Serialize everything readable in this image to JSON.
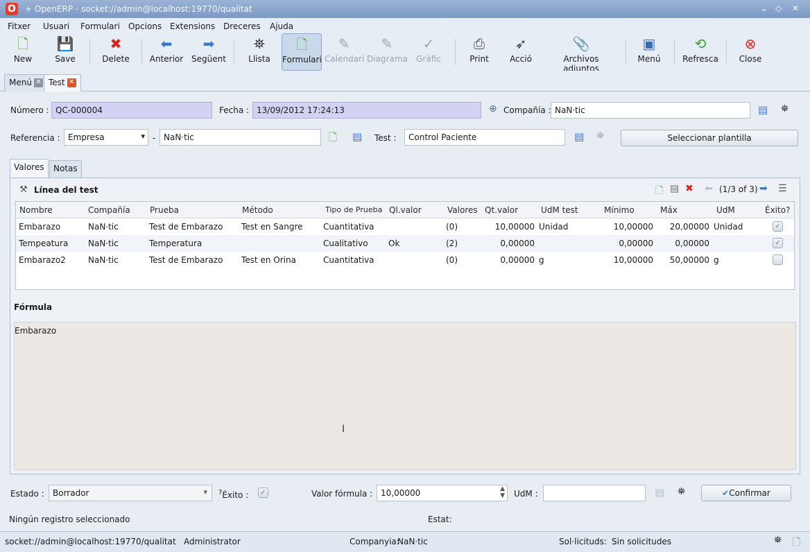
{
  "window": {
    "logo": "O",
    "title": "+ OpenERP - socket://admin@localhost:19770/qualitat",
    "controls": [
      "⌄",
      "◇",
      "✕"
    ]
  },
  "menubar": [
    "Fitxer",
    "Usuari",
    "Formulari",
    "Opcions",
    "Extensions",
    "Dreceres",
    "Ajuda"
  ],
  "toolbar": {
    "new": "New",
    "save": "Save",
    "delete": "Delete",
    "previous": "Anterior",
    "next": "Següent",
    "list": "Llista",
    "form": "Formulari",
    "calendar": "Calendari",
    "graph": "Diagrama",
    "chart": "Gràfic",
    "print": "Print",
    "action": "Acció",
    "attachments": "Archivos adjuntos",
    "menu": "Menú",
    "refresh": "Refresca",
    "close": "Close"
  },
  "tabs": [
    {
      "label": "Menú"
    },
    {
      "label": "Test"
    }
  ],
  "form": {
    "numero_label": "Número :",
    "numero_value": "QC-000004",
    "fecha_label": "Fecha :",
    "fecha_value": "13/09/2012 17:24:13",
    "compania_label": "Compañía :",
    "compania_value": "NaN·tic",
    "referencia_label": "Referencia :",
    "referencia_type": "Empresa",
    "referencia_dash": "-",
    "referencia_value": "NaN·tic",
    "test_label": "Test :",
    "test_value": "Control Paciente",
    "template_button": "Seleccionar plantilla"
  },
  "inner_tabs": [
    "Valores",
    "Notas"
  ],
  "lines": {
    "title": "Línea del test",
    "pager": "(1/3 of 3)",
    "columns": [
      "Nombre",
      "Compañía",
      "Prueba",
      "Método",
      "Tipo de Prueba",
      "Ql.valor",
      "Valores",
      "Qt.valor",
      "UdM test",
      "Mínimo",
      "Máx",
      "UdM",
      "Éxito?"
    ],
    "rows": [
      {
        "nombre": "Embarazo",
        "compania": "NaN·tic",
        "prueba": "Test de Embarazo",
        "metodo": "Test en Sangre",
        "tipo": "Cuantitativa",
        "qlvalor": "",
        "valores": "(0)",
        "qtvalor": "10,00000",
        "udmtest": "Unidad",
        "minimo": "10,00000",
        "max": "20,00000",
        "udm": "Unidad",
        "exito": true
      },
      {
        "nombre": "Tempeatura",
        "compania": "NaN·tic",
        "prueba": "Temperatura",
        "metodo": "",
        "tipo": "Cualitativo",
        "qlvalor": "Ok",
        "valores": "(2)",
        "qtvalor": "0,00000",
        "udmtest": "",
        "minimo": "0,00000",
        "max": "0,00000",
        "udm": "",
        "exito": true
      },
      {
        "nombre": "Embarazo2",
        "compania": "NaN·tic",
        "prueba": "Test de Embarazo",
        "metodo": "Test en Orina",
        "tipo": "Cuantitativa",
        "qlvalor": "",
        "valores": "(0)",
        "qtvalor": "0,00000",
        "udmtest": "g",
        "minimo": "10,00000",
        "max": "50,00000",
        "udm": "g",
        "exito": false
      }
    ]
  },
  "formula": {
    "label": "Fórmula",
    "value": "Embarazo"
  },
  "footer": {
    "estado_label": "Estado :",
    "estado_value": "Borrador",
    "exito_label": "Éxito :",
    "exito_prefix": "?",
    "valor_formula_label": "Valor fórmula :",
    "valor_formula_value": "10,00000",
    "udm_label": "UdM :",
    "udm_value": "",
    "confirm_button": "Confirmar",
    "no_record": "Ningún registro seleccionado",
    "estat_label": "Estat:"
  },
  "statusbar": {
    "connection": "socket://admin@localhost:19770/qualitat",
    "user": "Administrator",
    "company_label": "Companyia:",
    "company_value": "NaN·tic",
    "requests_label": "Sol·licituds:",
    "requests_value": "Sin solicitudes"
  },
  "colors": {
    "accent": "#7c98c4",
    "readonly_field": "#d2d3f3",
    "delete": "#d9261c",
    "arrow": "#3f78c9",
    "new": "#4caf30"
  }
}
